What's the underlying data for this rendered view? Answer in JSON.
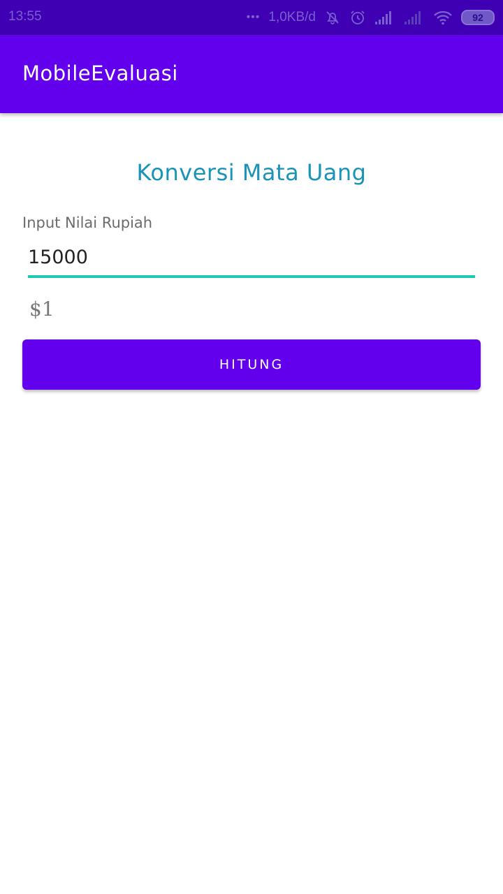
{
  "status_bar": {
    "time": "13:55",
    "dots": "•••",
    "network_speed": "1,0KB/d",
    "battery_level": "92",
    "icons": [
      "more-dots-icon",
      "bell-off-icon",
      "alarm-icon",
      "signal-icon",
      "signal-weak-icon",
      "wifi-icon",
      "battery-icon"
    ]
  },
  "app_bar": {
    "title": "MobileEvaluasi"
  },
  "main": {
    "heading": "Konversi Mata Uang",
    "input_label": "Input Nilai Rupiah",
    "input_value": "15000",
    "result": "$1",
    "button_label": "HITUNG"
  },
  "colors": {
    "primary": "#6200ee",
    "status_bar": "#3f00b3",
    "heading": "#1a93b8",
    "input_underline": "#1ec8b4"
  }
}
